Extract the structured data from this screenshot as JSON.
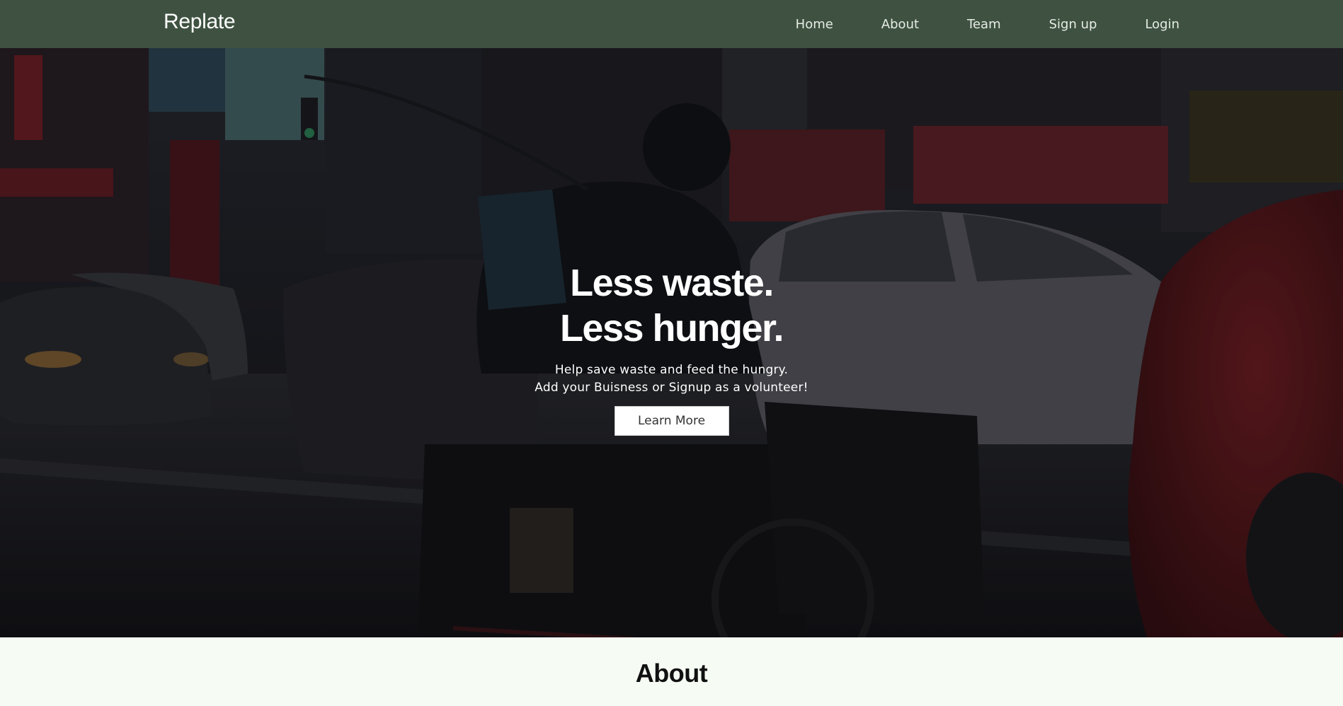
{
  "brand": {
    "name": "Replate"
  },
  "nav": {
    "items": [
      {
        "label": "Home"
      },
      {
        "label": "About"
      },
      {
        "label": "Team"
      },
      {
        "label": "Sign up"
      },
      {
        "label": "Login"
      }
    ]
  },
  "hero": {
    "title_line1": "Less waste.",
    "title_line2": "Less hunger.",
    "subtitle_line1": "Help save waste and feed the hungry.",
    "subtitle_line2": "Add your Buisness or Signup as a volunteer!",
    "cta_label": "Learn More"
  },
  "about": {
    "heading": "About"
  },
  "colors": {
    "navbar_bg": "#3f5241",
    "page_bg": "#f6fbf4",
    "accent_white": "#ffffff"
  }
}
